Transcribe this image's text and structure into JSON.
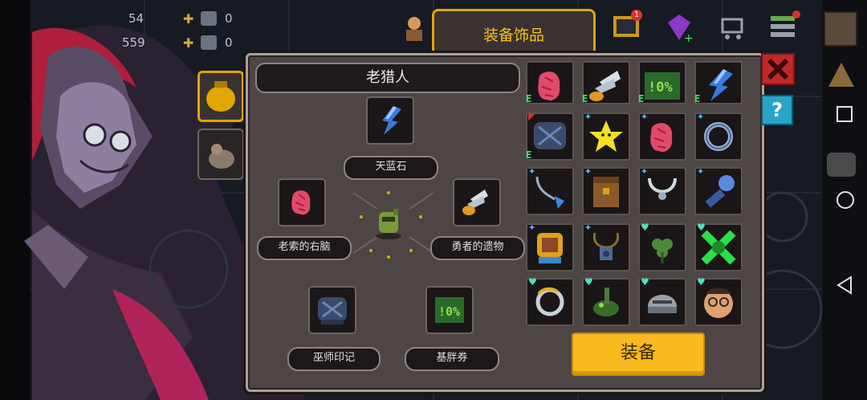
{
  "colors": {
    "accent_gold": "#f7b91d",
    "panel_bg": "#4e4644",
    "slot_bg": "#1b1718",
    "equipped_text": "#3ee86a",
    "rare_blue": "#4fb7ff",
    "heart_teal": "#4de2c0"
  },
  "top_bar": {
    "count_a_partial": "54",
    "count_b_partial": "559",
    "plus_a": "0",
    "plus_b": "0",
    "mail_badge": "1"
  },
  "tab": {
    "title": "装备饰品"
  },
  "character": {
    "name": "老猎人",
    "slots": {
      "top": {
        "label": "天蓝石",
        "icon": "blue-crystal-icon"
      },
      "left": {
        "label": "老索的右脑",
        "icon": "brain-icon"
      },
      "right": {
        "label": "勇者的遗物",
        "icon": "wing-relic-icon"
      },
      "bottom_left": {
        "label": "巫师印记",
        "icon": "wizard-mark-icon"
      },
      "bottom_right": {
        "label": "基胖券",
        "icon": "coupon-icon"
      }
    }
  },
  "inventory": [
    {
      "icon": "brain-icon",
      "equipped": true,
      "rarity": ""
    },
    {
      "icon": "wing-relic-icon",
      "equipped": true,
      "rarity": ""
    },
    {
      "icon": "coupon-icon",
      "equipped": true,
      "rarity": ""
    },
    {
      "icon": "blue-crystal-icon",
      "equipped": true,
      "rarity": ""
    },
    {
      "icon": "wizard-mark-icon",
      "equipped": true,
      "rarity": "red"
    },
    {
      "icon": "star-icon",
      "equipped": false,
      "rarity": "star"
    },
    {
      "icon": "brain-icon",
      "equipped": false,
      "rarity": "star"
    },
    {
      "icon": "ring-icon",
      "equipped": false,
      "rarity": "star"
    },
    {
      "icon": "pendant-icon",
      "equipped": false,
      "rarity": "star"
    },
    {
      "icon": "chest-icon",
      "equipped": false,
      "rarity": "star"
    },
    {
      "icon": "necklace-icon",
      "equipped": false,
      "rarity": "star"
    },
    {
      "icon": "torch-icon",
      "equipped": false,
      "rarity": "star"
    },
    {
      "icon": "armor-icon",
      "equipped": false,
      "rarity": "star"
    },
    {
      "icon": "amulet-icon",
      "equipped": false,
      "rarity": "star"
    },
    {
      "icon": "clover-icon",
      "equipped": false,
      "rarity": "heart"
    },
    {
      "icon": "green-x-icon",
      "equipped": false,
      "rarity": "heart"
    },
    {
      "icon": "moon-ring-icon",
      "equipped": false,
      "rarity": "heart"
    },
    {
      "icon": "frog-icon",
      "equipped": false,
      "rarity": "heart"
    },
    {
      "icon": "helmet-icon",
      "equipped": false,
      "rarity": "heart"
    },
    {
      "icon": "glasses-face-icon",
      "equipped": false,
      "rarity": "heart"
    }
  ],
  "buttons": {
    "equip": "装备"
  }
}
